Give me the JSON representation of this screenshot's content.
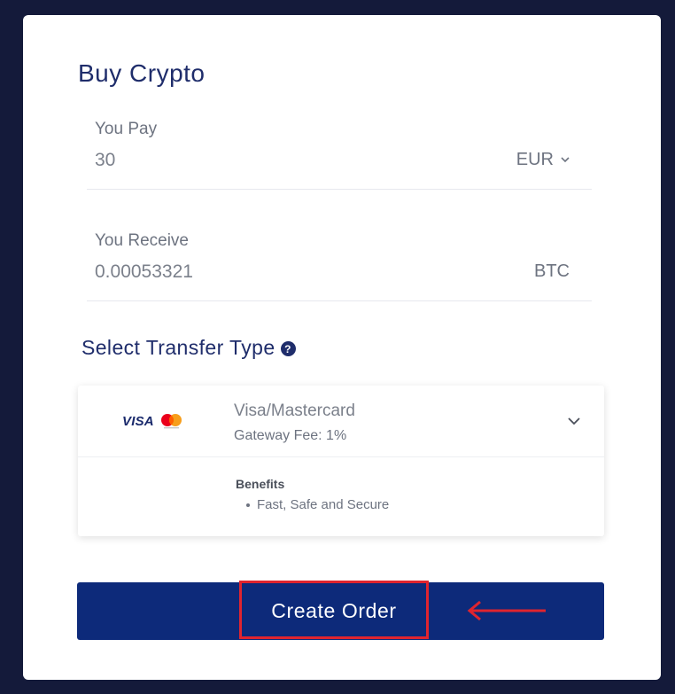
{
  "title": "Buy Crypto",
  "pay": {
    "label": "You Pay",
    "value": "30",
    "currency": "EUR"
  },
  "receive": {
    "label": "You Receive",
    "value": "0.00053321",
    "currency": "BTC"
  },
  "transfer": {
    "section_title": "Select Transfer Type",
    "help_icon": "?",
    "visa_text": "VISA",
    "method_name": "Visa/Mastercard",
    "fee": "Gateway Fee: 1%",
    "benefits_title": "Benefits",
    "benefits": [
      "Fast, Safe and Secure"
    ]
  },
  "button": {
    "label": "Create Order"
  },
  "colors": {
    "background": "#141a3a",
    "primary": "#0d2a7a",
    "title": "#1f2d6b",
    "highlight": "#e0242f"
  },
  "icons": {
    "currency_dropdown": "chevron-down-icon",
    "expand": "chevron-down-icon",
    "help": "question-circle-icon",
    "annotation": "arrow-left-icon",
    "mastercard": "mastercard-logo-icon"
  }
}
